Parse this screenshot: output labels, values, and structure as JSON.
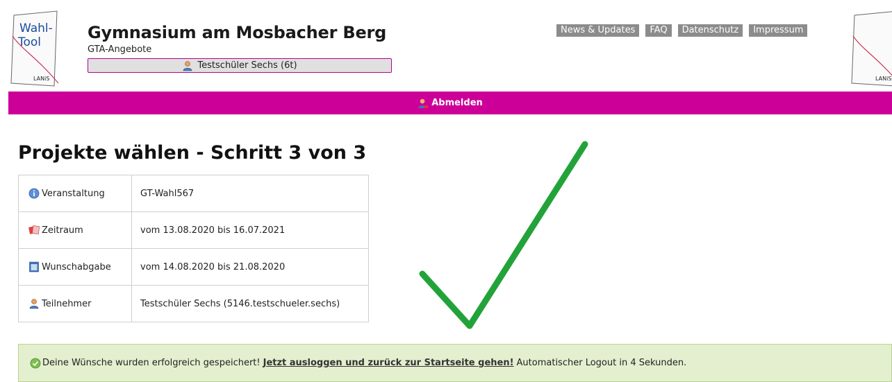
{
  "header": {
    "logo_text_line1": "Wahl-",
    "logo_text_line2": "Tool",
    "logo_brand": "LANiS",
    "school_name": "Gymnasium am Mosbacher Berg",
    "subtitle": "GTA-Angebote",
    "user_label": "Testschüler Sechs (6t)"
  },
  "topnav": {
    "items": [
      {
        "label": "News & Updates"
      },
      {
        "label": "FAQ"
      },
      {
        "label": "Datenschutz"
      },
      {
        "label": "Impressum"
      }
    ]
  },
  "bar": {
    "logout_label": "Abmelden",
    "color": "#cc0099"
  },
  "main": {
    "title": "Projekte wählen - Schritt 3 von 3",
    "rows": [
      {
        "icon": "info-icon",
        "label": "Veranstaltung",
        "value": "GT-Wahl567"
      },
      {
        "icon": "calendar-icon",
        "label": "Zeitraum",
        "value": "vom 13.08.2020 bis 16.07.2021"
      },
      {
        "icon": "form-icon",
        "label": "Wunschabgabe",
        "value": "vom 14.08.2020 bis 21.08.2020"
      },
      {
        "icon": "user-icon",
        "label": "Teilnehmer",
        "value": "Testschüler Sechs (5146.testschueler.sechs)"
      }
    ]
  },
  "message": {
    "prefix": "Deine Wünsche wurden erfolgreich gespeichert!",
    "link": "Jetzt ausloggen und zurück zur Startseite gehen!",
    "suffix": "Automatischer Logout in 4 Sekunden."
  },
  "colors": {
    "accent": "#cc0099",
    "success_bg": "#e4efcf",
    "check": "#22a33a"
  }
}
